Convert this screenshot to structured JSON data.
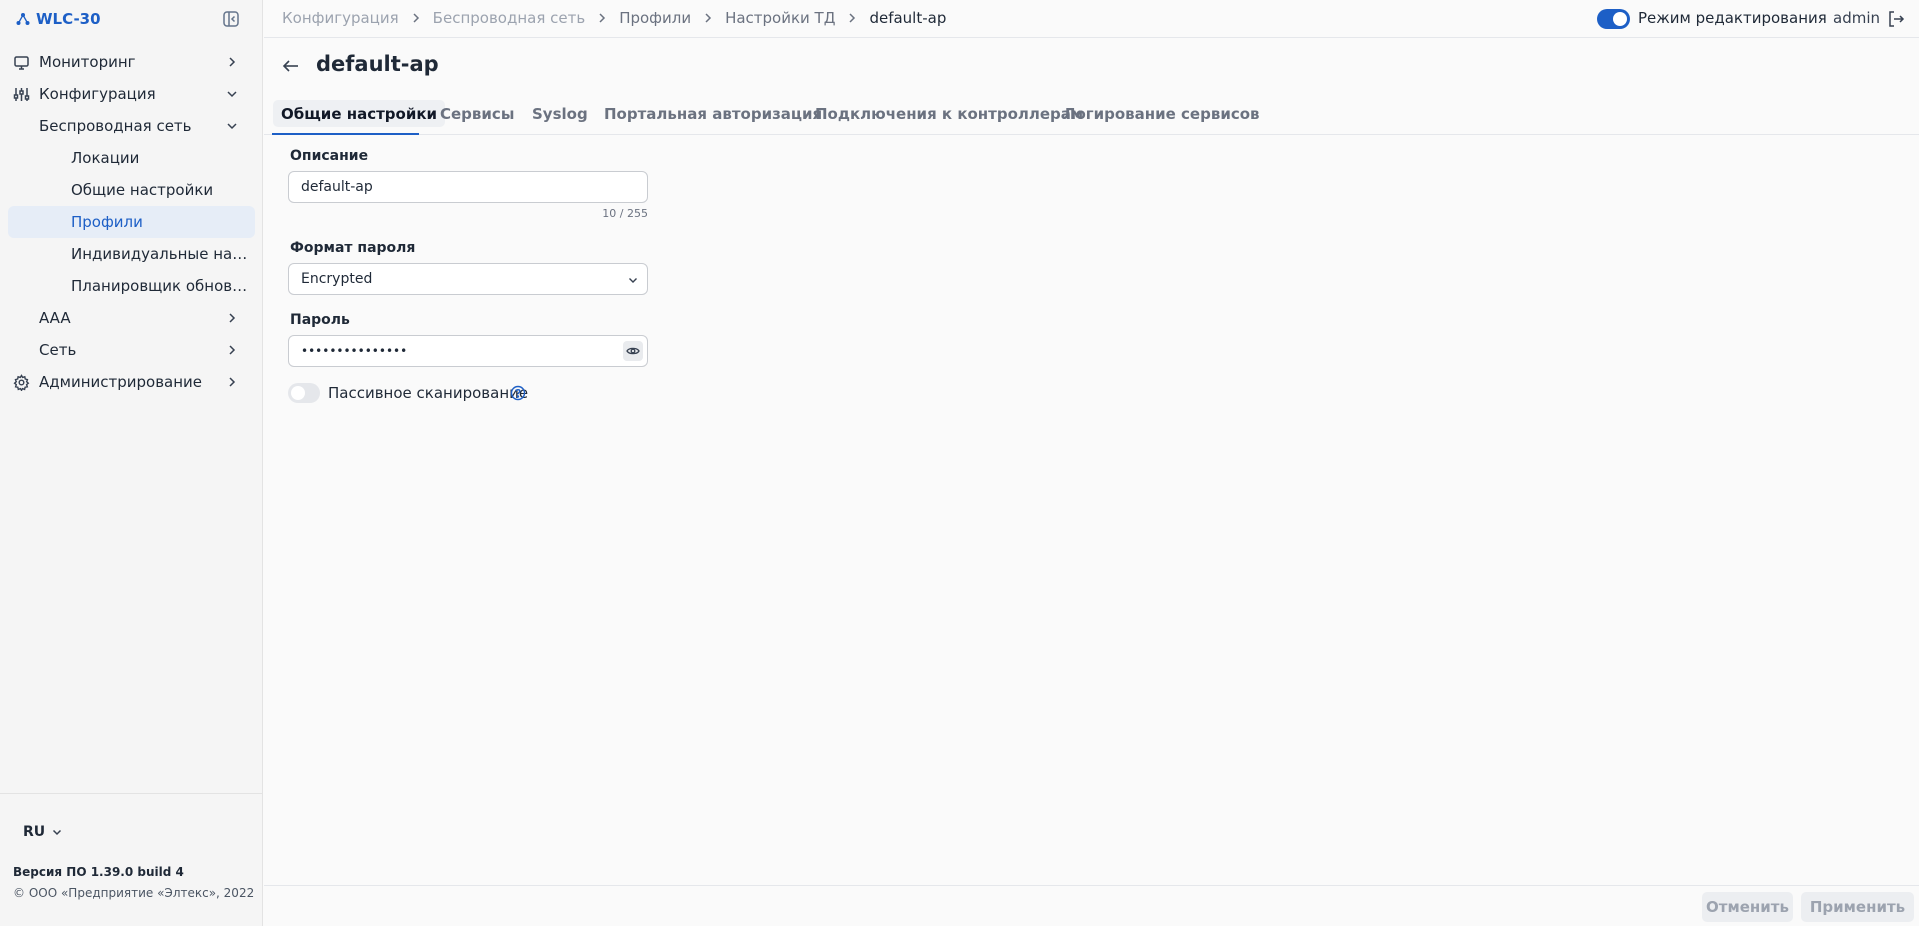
{
  "app": {
    "name": "WLC-30"
  },
  "sidebar": {
    "items": [
      {
        "label": "Мониторинг"
      },
      {
        "label": "Конфигурация"
      },
      {
        "label": "Беспроводная сеть"
      },
      {
        "label": "Локации"
      },
      {
        "label": "Общие настройки"
      },
      {
        "label": "Профили"
      },
      {
        "label": "Индивидуальные настройки"
      },
      {
        "label": "Планировщик обновлений"
      },
      {
        "label": "AAA"
      },
      {
        "label": "Сеть"
      },
      {
        "label": "Администрирование"
      }
    ],
    "language": "RU",
    "version": "Версия ПО 1.39.0 build 4",
    "copyright": "© ООО «Предприятие «Элтекс», 2022"
  },
  "breadcrumb": [
    "Конфигурация",
    "Беспроводная сеть",
    "Профили",
    "Настройки ТД",
    "default-ap"
  ],
  "topbar": {
    "edit_mode_label": "Режим редактирования",
    "edit_mode_on": true,
    "user": "admin"
  },
  "page": {
    "title": "default-ap"
  },
  "tabs": [
    {
      "label": "Общие настройки",
      "active": true
    },
    {
      "label": "Сервисы"
    },
    {
      "label": "Syslog"
    },
    {
      "label": "Портальная авторизация"
    },
    {
      "label": "Подключения к контроллерам"
    },
    {
      "label": "Логирование сервисов"
    }
  ],
  "form": {
    "description": {
      "label": "Описание",
      "value": "default-ap",
      "counter": "10 / 255"
    },
    "password_format": {
      "label": "Формат пароля",
      "value": "Encrypted"
    },
    "password": {
      "label": "Пароль",
      "value": "•••••••••••••••"
    },
    "passive_scan": {
      "label": "Пассивное сканирование",
      "enabled": false
    }
  },
  "footer": {
    "cancel_label": "Отменить",
    "apply_label": "Применить"
  },
  "colors": {
    "accent": "#1d5fc6",
    "active_nav_bg": "#e6edf7"
  }
}
